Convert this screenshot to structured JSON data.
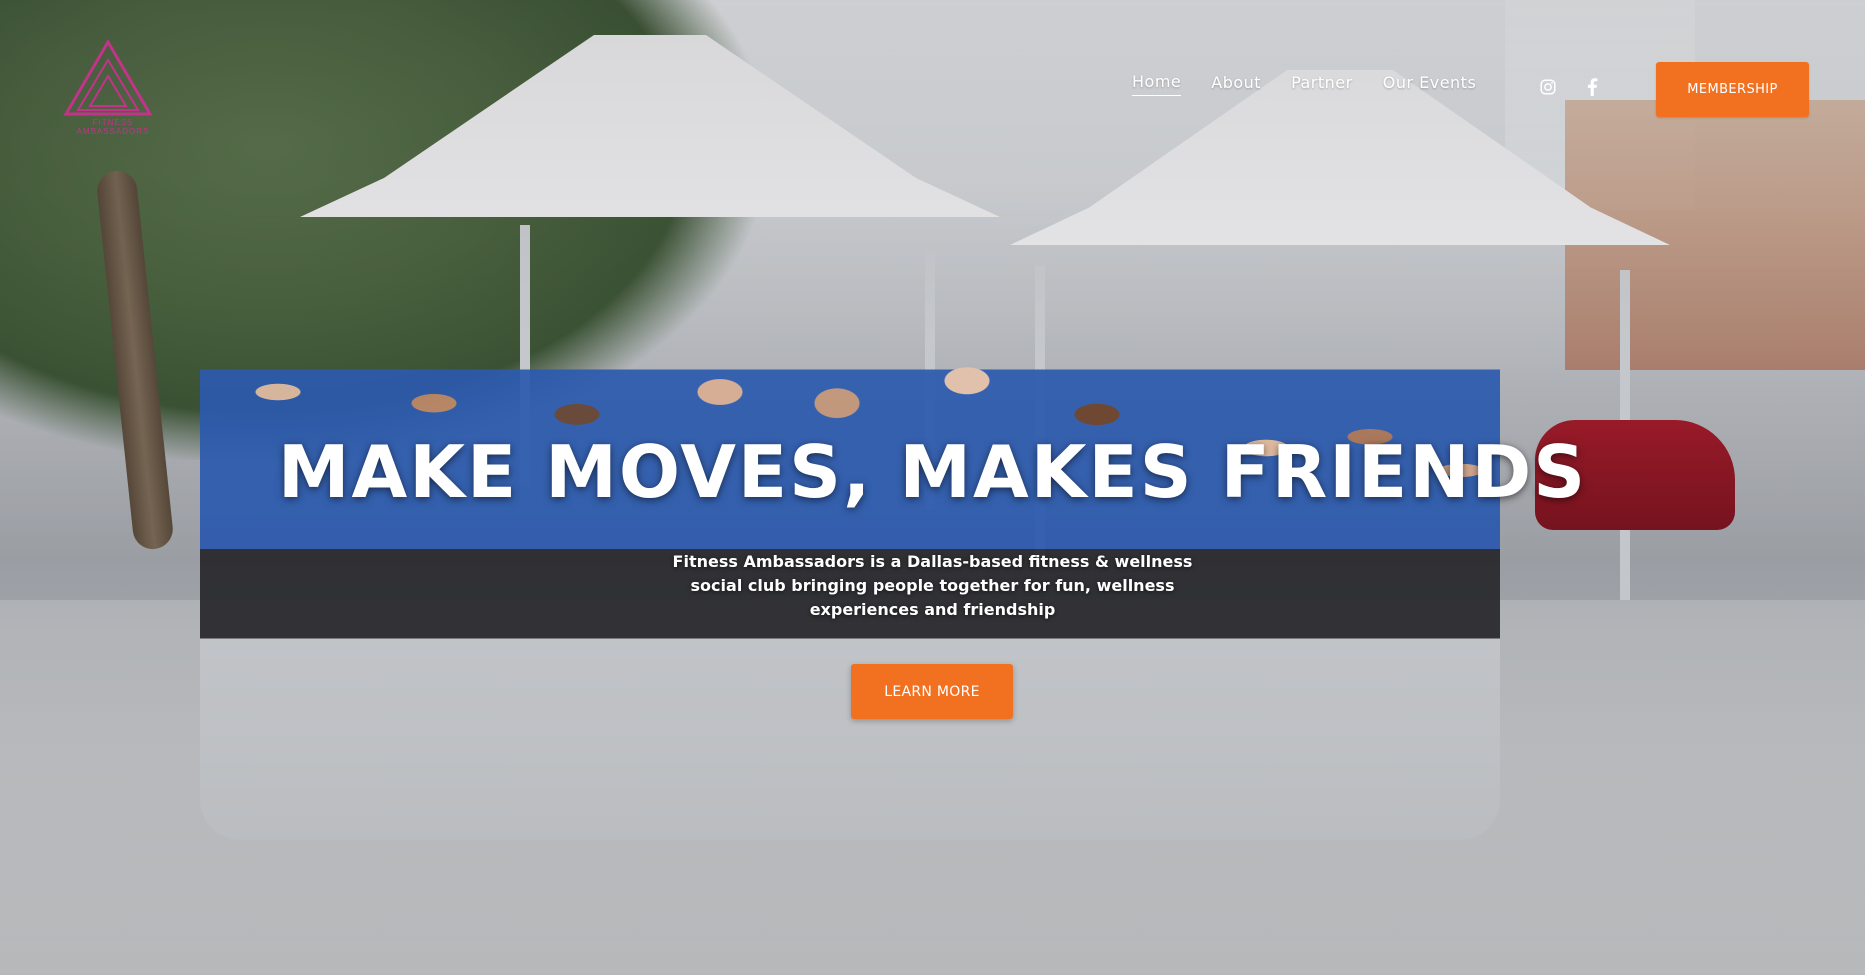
{
  "brand": {
    "logo_text": "FITNESS AMBASSADORS",
    "logo_color": "#c3338a"
  },
  "nav": {
    "items": [
      {
        "label": "Home",
        "active": true
      },
      {
        "label": "About",
        "active": false
      },
      {
        "label": "Partner",
        "active": false
      },
      {
        "label": "Our Events",
        "active": false
      }
    ]
  },
  "social": {
    "icons": [
      "instagram-icon",
      "facebook-icon"
    ]
  },
  "header": {
    "membership_label": "MEMBERSHIP"
  },
  "hero": {
    "title": "MAKE MOVES, MAKES FRIENDS",
    "subtitle": "Fitness Ambassadors is a Dallas-based fitness & wellness social club bringing people together for fun, wellness experiences and friendship",
    "cta_label": "LEARN MORE"
  },
  "colors": {
    "accent": "#f27121",
    "text_on_image": "#ffffff"
  }
}
